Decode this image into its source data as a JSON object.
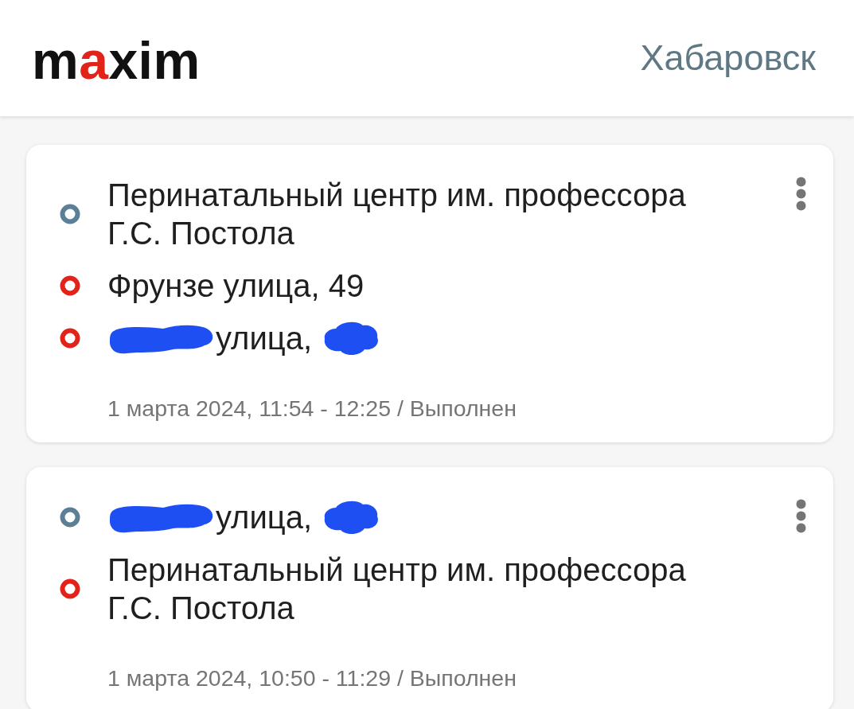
{
  "header": {
    "logo": [
      {
        "text": "m",
        "accent": false
      },
      {
        "text": "a",
        "accent": true
      },
      {
        "text": "xim",
        "accent": false
      }
    ],
    "city": "Хабаровск"
  },
  "orders": [
    {
      "points": [
        {
          "color": "#5b8096",
          "address": [
            {
              "kind": "text",
              "text": "Перинатальный центр им. профессора Г.С. Постола"
            }
          ]
        },
        {
          "color": "#e2231a",
          "address": [
            {
              "kind": "text",
              "text": "Фрунзе улица, 49"
            }
          ]
        },
        {
          "color": "#e2231a",
          "address": [
            {
              "kind": "scribble"
            },
            {
              "kind": "text",
              "text": "улица,"
            },
            {
              "kind": "blot"
            }
          ]
        }
      ],
      "summary": "1 марта 2024, 11:54 - 12:25 / Выполнен"
    },
    {
      "points": [
        {
          "color": "#5b8096",
          "address": [
            {
              "kind": "scribble"
            },
            {
              "kind": "text",
              "text": "улица,"
            },
            {
              "kind": "blot"
            }
          ]
        },
        {
          "color": "#e2231a",
          "address": [
            {
              "kind": "text",
              "text": "Перинатальный центр им. профессора Г.С. Постола"
            }
          ]
        }
      ],
      "summary": "1 марта 2024, 10:50 - 11:29 / Выполнен"
    }
  ]
}
